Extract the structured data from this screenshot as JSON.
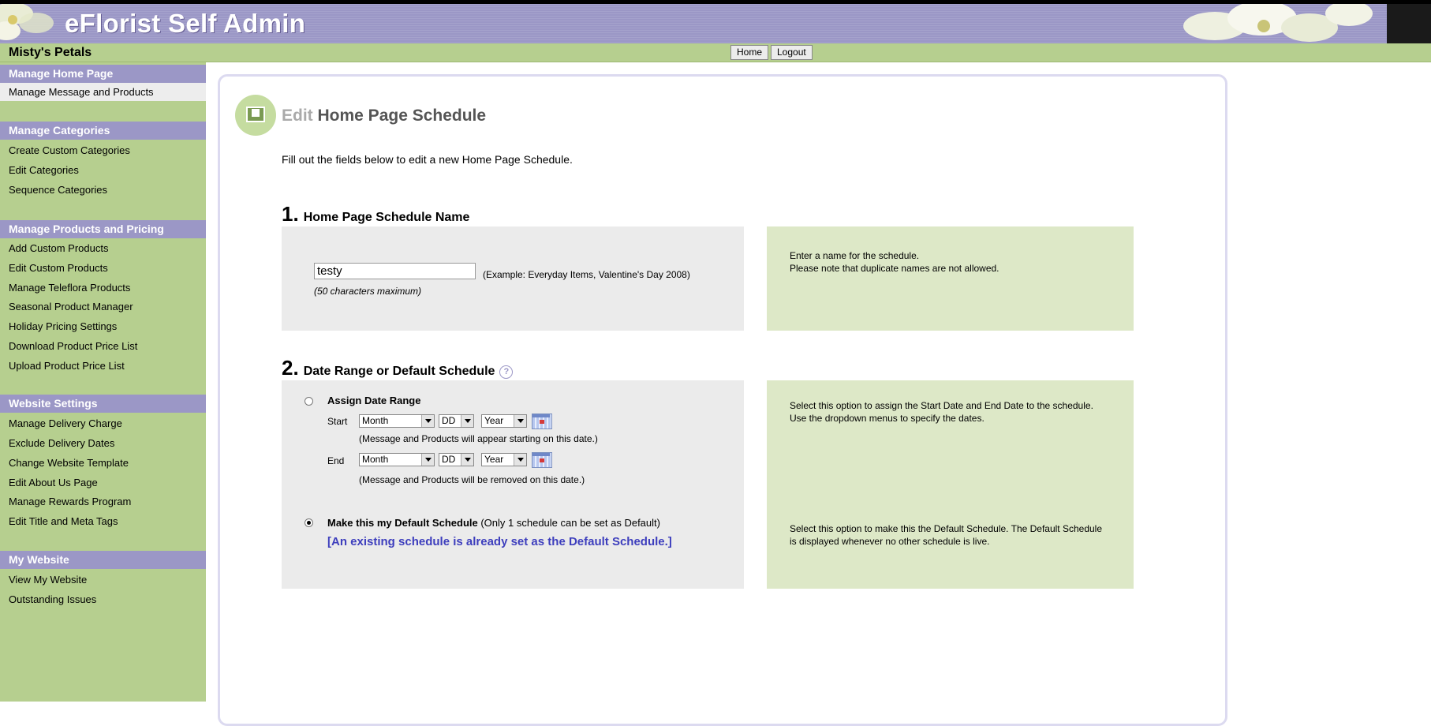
{
  "banner": {
    "title": "eFlorist Self Admin"
  },
  "shopbar": {
    "shop_name": "Misty's Petals",
    "home_label": "Home",
    "logout_label": "Logout"
  },
  "sidebar": {
    "sections": [
      {
        "title": "Manage Home Page",
        "items": [
          "Manage Message and Products"
        ]
      },
      {
        "title": "Manage Categories",
        "items": [
          "Create Custom Categories",
          "Edit Categories",
          "Sequence Categories"
        ]
      },
      {
        "title": "Manage Products and Pricing",
        "items": [
          "Add Custom Products",
          "Edit Custom Products",
          "Manage Teleflora Products",
          "Seasonal Product Manager",
          "Holiday Pricing Settings",
          "Download Product Price List",
          "Upload Product Price List"
        ]
      },
      {
        "title": "Website Settings",
        "items": [
          "Manage Delivery Charge",
          "Exclude Delivery Dates",
          "Change Website Template",
          "Edit About Us Page",
          "Manage Rewards Program",
          "Edit Title and Meta Tags"
        ]
      },
      {
        "title": "My Website",
        "items": [
          "View My Website",
          "Outstanding Issues"
        ]
      }
    ]
  },
  "main": {
    "title_prefix": "Edit",
    "title_rest": " Home Page Schedule",
    "intro": "Fill out the fields below to edit a new Home Page Schedule.",
    "step1": {
      "number": "1.",
      "heading": "Home Page Schedule Name",
      "input_value": "testy",
      "example": "(Example: Everyday Items, Valentine's Day 2008)",
      "limit": "(50 characters maximum)",
      "help_line1": "Enter a name for the schedule.",
      "help_line2": "Please note that duplicate names are not allowed."
    },
    "step2": {
      "number": "2.",
      "heading": "Date Range or Default Schedule",
      "help_icon": "?",
      "assign_label": "Assign Date Range",
      "start_label": "Start",
      "end_label": "End",
      "month": "Month",
      "day": "DD",
      "year": "Year",
      "start_note": "(Message and Products will appear starting on this date.)",
      "end_note": "(Message and Products will be removed on this date.)",
      "default_label": "Make this my Default Schedule",
      "default_note": " (Only 1 schedule can be set as Default)",
      "default_warning": "[An existing schedule is already set as the Default Schedule.]",
      "help_assign": "Select this option to assign the Start Date and End Date to the schedule. Use the dropdown menus to specify the dates.",
      "help_default": "Select this option to make this the Default Schedule. The Default Schedule is displayed whenever no other schedule is live."
    }
  }
}
